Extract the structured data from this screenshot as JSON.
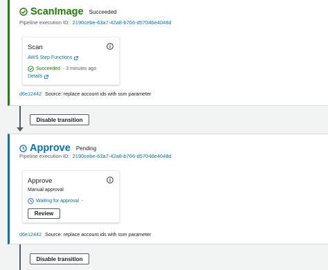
{
  "stages": [
    {
      "title": "ScanImage",
      "status": "Succeeded",
      "execution_label": "Pipeline execution ID:",
      "execution_id": "2190cebe-63a7-42a8-b766-d57046e4048d",
      "action": {
        "name": "Scan",
        "provider_link": "AWS Step Functions",
        "status": "Succeeded",
        "time": "- 3 minutes ago",
        "details_link": "Details"
      },
      "source": {
        "commit": "d6e12442",
        "text": "Source: replace account ids with ssm parameter"
      }
    },
    {
      "title": "Approve",
      "status": "Pending",
      "execution_label": "Pipeline execution ID:",
      "execution_id": "2190cebe-63a7-42a8-b766-d57046e4048d",
      "action": {
        "name": "Approve",
        "subtitle": "Manual approval",
        "status": "Waiting for approval",
        "status_suffix": "-",
        "button": "Review"
      },
      "source": {
        "commit": "d6e12442",
        "text": "Source: replace account ids with ssm parameter"
      }
    }
  ],
  "transitions": [
    {
      "label": "Disable transition"
    },
    {
      "label": "Disable transition"
    }
  ],
  "colors": {
    "succeeded": "#1d8102",
    "pending": "#0073bb",
    "link": "#0073bb"
  },
  "icons": {
    "succeeded": "check-circle-icon",
    "pending": "clock-icon",
    "info": "info-icon",
    "external": "external-link-icon"
  }
}
